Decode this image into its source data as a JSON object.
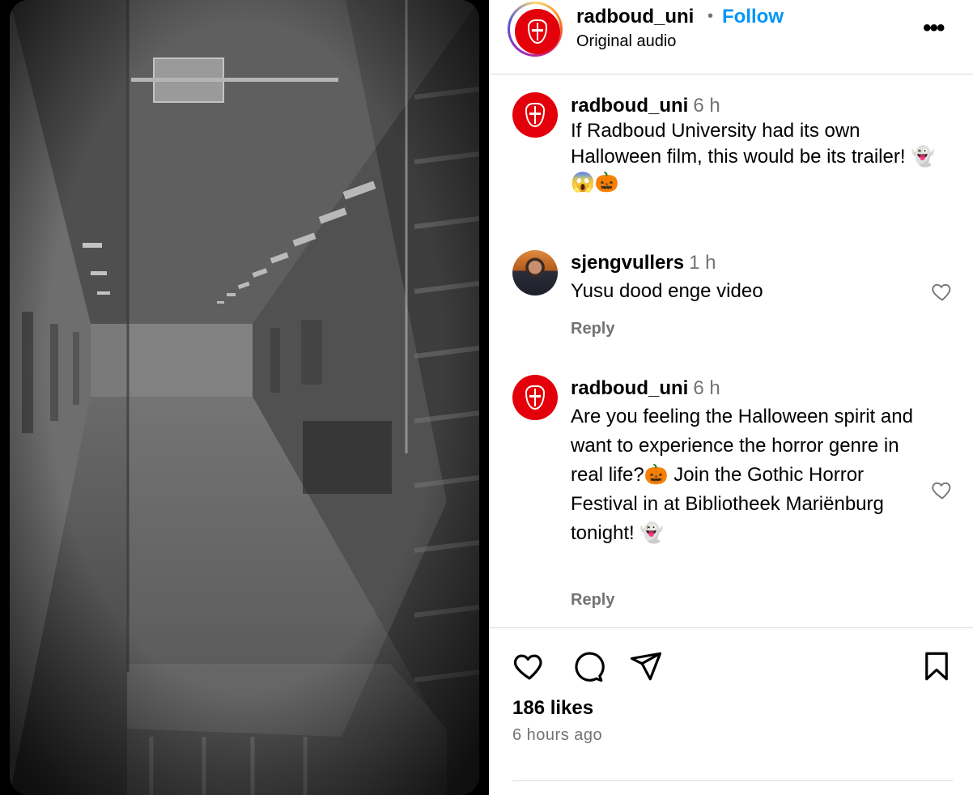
{
  "post": {
    "username": "radboud_uni",
    "separator": "•",
    "follow_label": "Follow",
    "audio": "Original audio",
    "more_icon": "more-horizontal-icon",
    "brand_color": "#e3000b",
    "link_color": "#0095f6"
  },
  "comments": [
    {
      "username": "radboud_uni",
      "time": "6 h",
      "text": "If Radboud University had its own Halloween film, this would be its trailer! 👻😱🎃"
    },
    {
      "username": "sjengvullers",
      "time": "1 h",
      "text": "Yusu dood enge video",
      "reply": "Reply"
    },
    {
      "username": "radboud_uni",
      "time": "6 h",
      "text": "Are you feeling the Halloween spirit and want to experience the horror genre in real life?🎃 Join the Gothic Horror Festival in at Bibliotheek Mariënburg tonight! 👻",
      "reply": "Reply"
    }
  ],
  "actions": {
    "icons": [
      "heart-icon",
      "comment-icon",
      "share-icon",
      "bookmark-icon"
    ],
    "likes": "186 likes",
    "time_ago": "6 hours ago"
  }
}
